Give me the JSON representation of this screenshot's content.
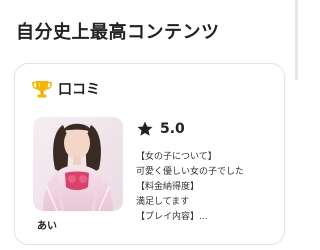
{
  "section": {
    "title": "自分史上最高コンテンツ"
  },
  "card": {
    "icon": "trophy-icon",
    "heading": "口コミ",
    "reviewer": "あい",
    "rating_icon": "star-icon",
    "rating": "5.0",
    "lines": [
      "【女の子について】",
      "可愛く優しい女の子でした",
      "【料金納得度】",
      "満足してます",
      "【プレイ内容】..."
    ]
  },
  "colors": {
    "trophy": "#f2b705",
    "card_border": "#e2e2e2",
    "text": "#222222"
  }
}
